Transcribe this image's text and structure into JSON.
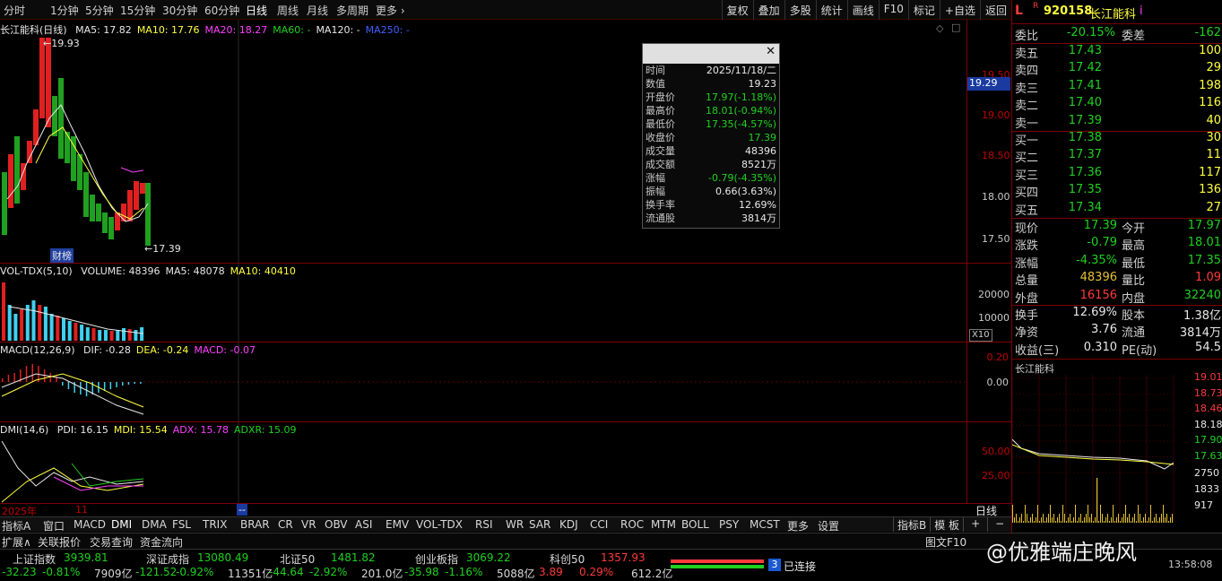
{
  "periods": [
    "分时",
    "1分钟",
    "5分钟",
    "15分钟",
    "30分钟",
    "60分钟",
    "日线",
    "周线",
    "月线",
    "多周期",
    "更多"
  ],
  "period_active": "日线",
  "tools": [
    "复权",
    "叠加",
    "多股",
    "统计",
    "画线",
    "F10",
    "标记",
    "+自选",
    "返回"
  ],
  "main_panel": {
    "title": "长江能科(日线)",
    "ma": [
      {
        "label": "MA5: 17.82",
        "color": "#e8e8e8"
      },
      {
        "label": "MA10: 17.76",
        "color": "#ffff40"
      },
      {
        "label": "MA20: 18.27",
        "color": "#ff40ff"
      },
      {
        "label": "MA60: -",
        "color": "#20d020"
      },
      {
        "label": "MA120: -",
        "color": "#e8e8e8"
      },
      {
        "label": "MA250: -",
        "color": "#4060ff"
      }
    ],
    "high_mark": "19.93",
    "low_mark": "17.39",
    "event_tag": "财榜",
    "y_labels": [
      "19.50",
      "19.00",
      "18.50",
      "18.00",
      "17.50"
    ],
    "cursor_price": "19.29"
  },
  "vol_panel": {
    "title": "VOL-TDX(5,10)",
    "items": [
      {
        "label": "VOLUME: 48396",
        "color": "#e8e8e8"
      },
      {
        "label": "MA5: 48078",
        "color": "#e8e8e8"
      },
      {
        "label": "MA10: 40410",
        "color": "#ffff40"
      }
    ],
    "y_labels": [
      "20000",
      "10000"
    ],
    "unit": "X10"
  },
  "macd_panel": {
    "title": "MACD(12,26,9)",
    "items": [
      {
        "label": "DIF: -0.28",
        "color": "#e8e8e8"
      },
      {
        "label": "DEA: -0.24",
        "color": "#ffff40"
      },
      {
        "label": "MACD: -0.07",
        "color": "#ff40ff"
      }
    ],
    "y_labels": [
      "0.20",
      "0.00"
    ]
  },
  "dmi_panel": {
    "title": "DMI(14,6)",
    "items": [
      {
        "label": "PDI: 16.15",
        "color": "#e8e8e8"
      },
      {
        "label": "MDI: 15.54",
        "color": "#ffff40"
      },
      {
        "label": "ADX: 15.78",
        "color": "#ff40ff"
      },
      {
        "label": "ADXR: 15.09",
        "color": "#20d020"
      }
    ],
    "y_labels": [
      "50.00",
      "25.00"
    ]
  },
  "x_axis": {
    "year": "2025年",
    "month": "11",
    "cursor": "--",
    "period_label": "日线"
  },
  "tooltip": {
    "rows": [
      {
        "k": "时间",
        "v": "2025/11/18/二",
        "c": "#e8e8e8"
      },
      {
        "k": "数值",
        "v": "19.23",
        "c": "#e8e8e8"
      },
      {
        "k": "开盘价",
        "v": "17.97(-1.18%)",
        "c": "#20d020"
      },
      {
        "k": "最高价",
        "v": "18.01(-0.94%)",
        "c": "#20d020"
      },
      {
        "k": "最低价",
        "v": "17.35(-4.57%)",
        "c": "#20d020"
      },
      {
        "k": "收盘价",
        "v": "17.39",
        "c": "#20d020"
      },
      {
        "k": "成交量",
        "v": "48396",
        "c": "#e8e8e8"
      },
      {
        "k": "成交额",
        "v": "8521万",
        "c": "#e8e8e8"
      },
      {
        "k": "涨幅",
        "v": "-0.79(-4.35%)",
        "c": "#20d020"
      },
      {
        "k": "振幅",
        "v": "0.66(3.63%)",
        "c": "#e8e8e8"
      },
      {
        "k": "换手率",
        "v": "12.69%",
        "c": "#e8e8e8"
      },
      {
        "k": "流通股",
        "v": "3814万",
        "c": "#e8e8e8"
      }
    ]
  },
  "quote": {
    "flag": "L",
    "rtag": "R",
    "code": "920158",
    "name": "长江能科",
    "info": "i",
    "wei_bi_label": "委比",
    "wei_bi": "-20.15%",
    "wei_cha_label": "委差",
    "wei_cha": "-162",
    "sells": [
      {
        "label": "卖五",
        "price": "17.43",
        "vol": "100"
      },
      {
        "label": "卖四",
        "price": "17.42",
        "vol": "29"
      },
      {
        "label": "卖三",
        "price": "17.41",
        "vol": "198"
      },
      {
        "label": "卖二",
        "price": "17.40",
        "vol": "116"
      },
      {
        "label": "卖一",
        "price": "17.39",
        "vol": "40"
      }
    ],
    "buys": [
      {
        "label": "买一",
        "price": "17.38",
        "vol": "30"
      },
      {
        "label": "买二",
        "price": "17.37",
        "vol": "11"
      },
      {
        "label": "买三",
        "price": "17.36",
        "vol": "117"
      },
      {
        "label": "买四",
        "price": "17.35",
        "vol": "136"
      },
      {
        "label": "买五",
        "price": "17.34",
        "vol": "27"
      }
    ],
    "stats": [
      {
        "l1": "现价",
        "v1": "17.39",
        "c1": "#20d020",
        "l2": "今开",
        "v2": "17.97",
        "c2": "#20d020"
      },
      {
        "l1": "涨跌",
        "v1": "-0.79",
        "c1": "#20d020",
        "l2": "最高",
        "v2": "18.01",
        "c2": "#20d020"
      },
      {
        "l1": "涨幅",
        "v1": "-4.35%",
        "c1": "#20d020",
        "l2": "最低",
        "v2": "17.35",
        "c2": "#20d020"
      },
      {
        "l1": "总量",
        "v1": "48396",
        "c1": "#e6c230",
        "l2": "量比",
        "v2": "1.09",
        "c2": "#ff3a3a"
      },
      {
        "l1": "外盘",
        "v1": "16156",
        "c1": "#ff3a3a",
        "l2": "内盘",
        "v2": "32240",
        "c2": "#20d020"
      }
    ],
    "stats2": [
      {
        "l1": "换手",
        "v1": "12.69%",
        "l2": "股本",
        "v2": "1.38亿"
      },
      {
        "l1": "净资",
        "v1": "3.76",
        "l2": "流通",
        "v2": "3814万"
      },
      {
        "l1": "收益(三)",
        "v1": "0.310",
        "l2": "PE(动)",
        "v2": "54.5"
      }
    ]
  },
  "minichart": {
    "title": "长江能科",
    "y_labels": [
      {
        "v": "19.01",
        "c": "#ff3a3a"
      },
      {
        "v": "18.73",
        "c": "#ff3a3a"
      },
      {
        "v": "18.46",
        "c": "#ff3a3a"
      },
      {
        "v": "18.18",
        "c": "#e8e8e8"
      },
      {
        "v": "17.90",
        "c": "#20d020"
      },
      {
        "v": "17.63",
        "c": "#20d020"
      }
    ],
    "vol_labels": [
      "2750",
      "1833",
      "917"
    ]
  },
  "bottom_tabs": [
    "指标A",
    "窗口",
    "MACD",
    "DMI",
    "DMA",
    "FSL",
    "TRIX",
    "BRAR",
    "CR",
    "VR",
    "OBV",
    "ASI",
    "EMV",
    "VOL-TDX",
    "RSI",
    "WR",
    "SAR",
    "KDJ",
    "CCI",
    "ROC",
    "MTM",
    "BOLL",
    "PSY",
    "MCST",
    "更多",
    "设置"
  ],
  "bottom_tab_active": "DMI",
  "bottom_right_tabs": [
    "指标B",
    "模 板",
    "+",
    "−"
  ],
  "ext_tabs": [
    "扩展∧",
    "关联报价",
    "交易查询",
    "资金流向"
  ],
  "ext_right": "图文F10",
  "indices": [
    {
      "name": "上证指数",
      "price": "3939.81",
      "chg": "-32.23",
      "pct": "-0.81%",
      "amt": "7909亿",
      "color": "#20d020"
    },
    {
      "name": "深证成指",
      "price": "13080.49",
      "chg": "-121.52",
      "pct": "-0.92%",
      "amt": "11351亿",
      "color": "#20d020"
    },
    {
      "name": "北证50",
      "price": "1481.82",
      "chg": "-44.64",
      "pct": "-2.92%",
      "amt": "201.0亿",
      "color": "#20d020"
    },
    {
      "name": "创业板指",
      "price": "3069.22",
      "chg": "-35.98",
      "pct": "-1.16%",
      "amt": "5088亿",
      "color": "#20d020"
    },
    {
      "name": "科创50",
      "price": "1357.93",
      "chg": "3.89",
      "pct": "0.29%",
      "amt": "612.2亿",
      "color": "#ff3a3a"
    }
  ],
  "connection": {
    "badge": "3",
    "text": "已连接"
  },
  "clock": "13:58:08",
  "watermark": "@优雅端庄晚风"
}
